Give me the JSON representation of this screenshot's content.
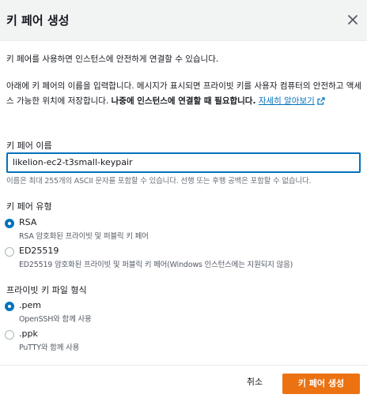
{
  "dialog": {
    "title": "키 페어 생성"
  },
  "description": {
    "line1": "키 페어를 사용하면 인스턴스에 안전하게 연결할 수 있습니다.",
    "line2_part1": "아래에 키 페어의 이름을 입력합니다. 메시지가 표시되면 프라이빗 키를 사용자 컴퓨터의 안전하고 액세스 가능한 위치에 저장합니다.",
    "line2_bold": "나중에 인스턴스에 연결할 때 필요합니다.",
    "learn_more": "자세히 알아보기"
  },
  "key_name": {
    "label": "키 페어 이름",
    "value": "likelion-ec2-t3small-keypair",
    "hint": "이름은 최대 255개의 ASCII 문자를 포함할 수 있습니다. 선행 또는 후행 공백은 포함할 수 없습니다."
  },
  "key_type": {
    "label": "키 페어 유형",
    "options": [
      {
        "label": "RSA",
        "sub": "RSA 암호화된 프라이빗 및 퍼블릭 키 페어",
        "checked": true
      },
      {
        "label": "ED25519",
        "sub": "ED25519 암호화된 프라이빗 및 퍼블릭 키 페어(Windows 인스턴스에는 지원되지 않음)",
        "checked": false
      }
    ]
  },
  "file_format": {
    "label": "프라이빗 키 파일 형식",
    "options": [
      {
        "label": ".pem",
        "sub": "OpenSSH와 함께 사용",
        "checked": true
      },
      {
        "label": ".ppk",
        "sub": "PuTTY와 함께 사용",
        "checked": false
      }
    ]
  },
  "footer": {
    "cancel_label": "취소",
    "create_label": "키 페어 생성"
  },
  "colors": {
    "accent": "#0073bb",
    "primary_button": "#ec7211",
    "header_bg": "#f2f3f3"
  }
}
